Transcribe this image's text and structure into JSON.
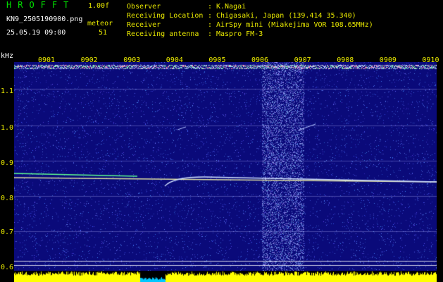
{
  "header": {
    "app_name": "HROFFT",
    "version": "1.00f",
    "filename": "KN9_2505190900.png",
    "datetime": "25.05.19 09:00",
    "meteor_label": "meteor",
    "meteor_count": "51",
    "info": [
      {
        "key": "Observer",
        "value": "K.Nagai"
      },
      {
        "key": "Receiving Location",
        "value": "Chigasaki, Japan (139.414 35.340)"
      },
      {
        "key": "Receiver",
        "value": "AirSpy mini (Miakejima VOR 108.65MHz)"
      },
      {
        "key": "Receiving antenna",
        "value": "Maspro FM-3"
      }
    ]
  },
  "axis": {
    "unit": "kHz",
    "time_labels": [
      "0901",
      "0902",
      "0903",
      "0904",
      "0905",
      "0906",
      "0907",
      "0908",
      "0909",
      "0910"
    ],
    "freq_labels": [
      "1.1",
      "1.0",
      "0.9",
      "0.8",
      "0.7",
      "0.6"
    ]
  },
  "colors": {
    "background": "#0a0a7a",
    "noise": "#4a60ff",
    "signal": "#e0e0a0",
    "activity": "#ffff00",
    "activity_low": "#00c8ff"
  }
}
